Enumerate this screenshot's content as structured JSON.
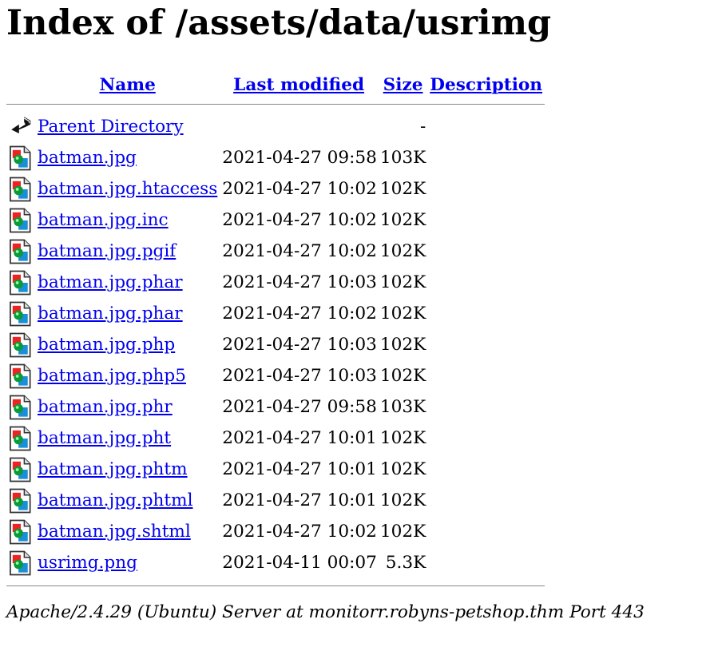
{
  "title": "Index of /assets/data/usrimg",
  "columns": {
    "name": "Name",
    "last_modified": "Last modified",
    "size": "Size",
    "description": "Description"
  },
  "parent": {
    "label": "Parent Directory",
    "size": "-",
    "icon": "back-arrow-icon"
  },
  "files": [
    {
      "name": "batman.jpg",
      "modified": "2021-04-27 09:58",
      "size": "103K"
    },
    {
      "name": "batman.jpg.htaccess",
      "modified": "2021-04-27 10:02",
      "size": "102K"
    },
    {
      "name": "batman.jpg.inc",
      "modified": "2021-04-27 10:02",
      "size": "102K"
    },
    {
      "name": "batman.jpg.pgif",
      "modified": "2021-04-27 10:02",
      "size": "102K"
    },
    {
      "name": "batman.jpg.phar",
      "modified": "2021-04-27 10:03",
      "size": "102K"
    },
    {
      "name": "batman.jpg.phar",
      "modified": "2021-04-27 10:02",
      "size": "102K"
    },
    {
      "name": "batman.jpg.php",
      "modified": "2021-04-27 10:03",
      "size": "102K"
    },
    {
      "name": "batman.jpg.php5",
      "modified": "2021-04-27 10:03",
      "size": "102K"
    },
    {
      "name": "batman.jpg.phr",
      "modified": "2021-04-27 09:58",
      "size": "103K"
    },
    {
      "name": "batman.jpg.pht",
      "modified": "2021-04-27 10:01",
      "size": "102K"
    },
    {
      "name": "batman.jpg.phtm",
      "modified": "2021-04-27 10:01",
      "size": "102K"
    },
    {
      "name": "batman.jpg.phtml",
      "modified": "2021-04-27 10:01",
      "size": "102K"
    },
    {
      "name": "batman.jpg.shtml",
      "modified": "2021-04-27 10:02",
      "size": "102K"
    },
    {
      "name": "usrimg.png",
      "modified": "2021-04-11 00:07",
      "size": "5.3K"
    }
  ],
  "footer": "Apache/2.4.29 (Ubuntu) Server at monitorr.robyns-petshop.thm Port 443",
  "colors": {
    "link": "#0000ee",
    "rule": "#888888"
  }
}
